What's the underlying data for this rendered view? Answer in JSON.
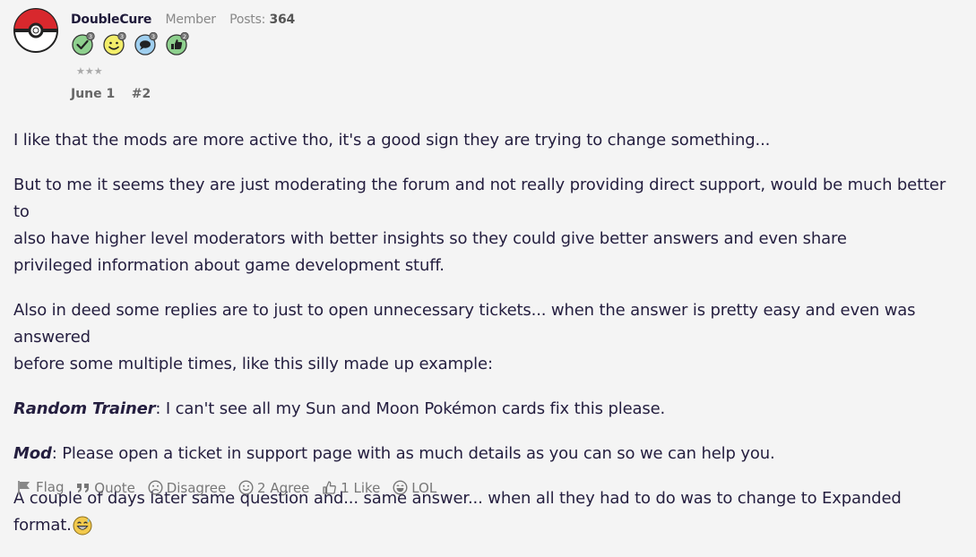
{
  "author": {
    "name": "DoubleCure",
    "role": "Member",
    "posts_label": "Posts:",
    "posts_count": "364",
    "avatar_icon": "pokeball-icon"
  },
  "badges": [
    {
      "icon": "check-badge-icon",
      "count": "3",
      "color": "#8ed08e"
    },
    {
      "icon": "smiley-badge-icon",
      "count": "3",
      "color": "#f3ee6a"
    },
    {
      "icon": "chat-badge-icon",
      "count": "3",
      "color": "#9fcfef"
    },
    {
      "icon": "thumb-badge-icon",
      "count": "2",
      "color": "#8ed08e"
    }
  ],
  "rank_stars": "★★★",
  "post_meta": {
    "date": "June 1",
    "number": "#2"
  },
  "body": {
    "p1": "I like that the mods are more active tho, it's a good sign they are trying to change something...",
    "p2_line1": "But to me it seems they are just moderating the forum and not really providing direct support, would be much better to",
    "p2_line2": "also have higher level moderators with better insights so they could give better answers and even share",
    "p2_line3": "privileged information about game development stuff.",
    "p3_line1": "Also in deed some replies are to just to open unnecessary tickets... when the answer is pretty easy and even was answered",
    "p3_line2": "before some multiple times, like this silly made up example:",
    "p4_speaker": "Random Trainer",
    "p4_text": ": I can't see all my Sun and Moon Pokémon cards fix this please.",
    "p5_speaker": "Mod",
    "p5_text": ": Please open a ticket in support page with as much details as you can so we can help you.",
    "p6": "A couple of days later same question and... same answer... when all they had to do was to change to Expanded format.",
    "p6_emoji": "grinning-sweat-emoji"
  },
  "actions": {
    "flag": "Flag",
    "quote": "Quote",
    "disagree": "Disagree",
    "agree": "2 Agree",
    "like": "1 Like",
    "lol": "LOL"
  },
  "colors": {
    "background": "#f4f4f4",
    "author": "#1f1a3a",
    "text": "#241e3f",
    "muted": "#777777"
  }
}
